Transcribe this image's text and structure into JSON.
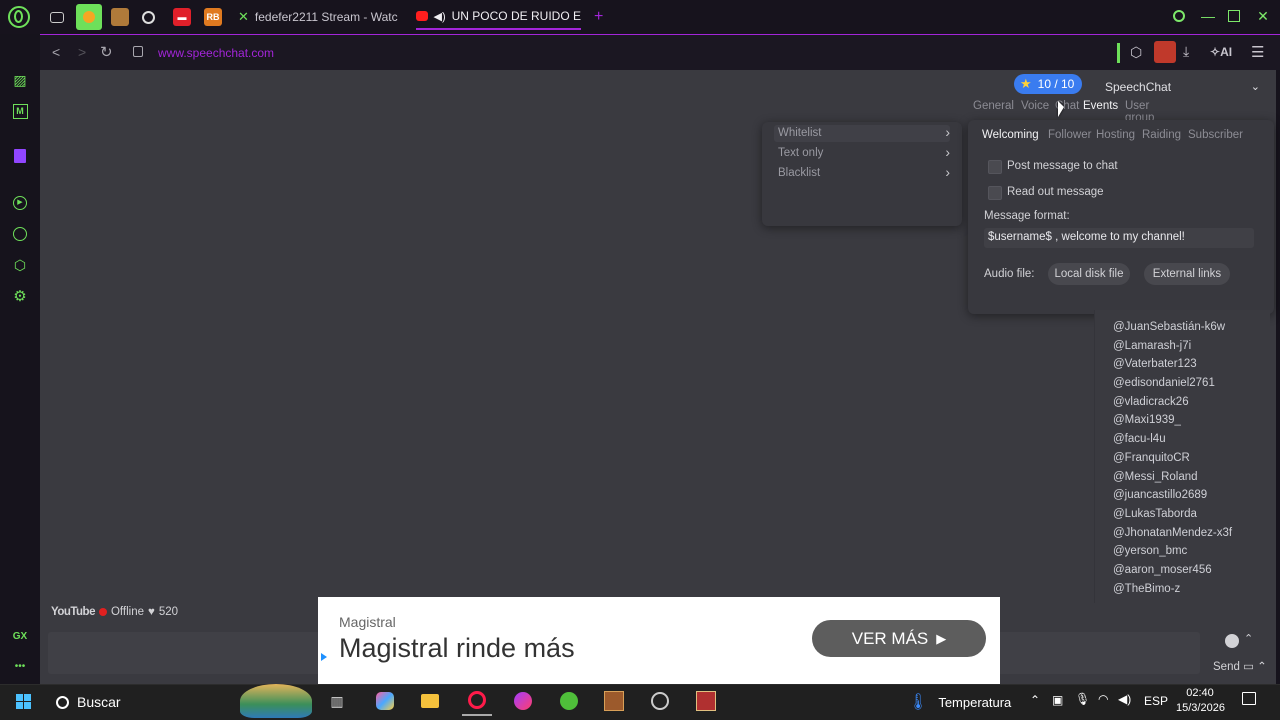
{
  "browser": {
    "tabs": [
      {
        "label": "fedefer2211 Stream - Watc",
        "icon": "twitch-extension-icon"
      },
      {
        "label": "UN POCO DE RUIDO E",
        "icon": "youtube-icon"
      }
    ],
    "new_tab": "+",
    "address": "www.speechchat.com",
    "ai_label": "AI",
    "accent_color": "#a325d9",
    "gx_green": "#6ee05a"
  },
  "sidebar": {
    "gx_label": "GX",
    "more": "•••"
  },
  "speechchat": {
    "rating": "10 / 10",
    "channel_select": "SpeechChat",
    "main_tabs": [
      "General",
      "Voice",
      "Chat",
      "Events",
      "User group"
    ],
    "active_main_tab": "Events",
    "list_menu": [
      "Whitelist",
      "Text only",
      "Blacklist"
    ],
    "event_tabs": [
      "Welcoming",
      "Follower",
      "Hosting",
      "Raiding",
      "Subscriber"
    ],
    "active_event_tab": "Welcoming",
    "post_message": "Post message to chat",
    "read_out": "Read out message",
    "message_format_label": "Message format:",
    "message_format_value": "$username$ , welcome to my channel!",
    "audio_file_label": "Audio file:",
    "local_disk_button": "Local disk file",
    "external_links_button": "External links"
  },
  "users": [
    "@JuanSebastián-k6w",
    "@Lamarash-j7i",
    "@Vaterbater123",
    "@edisondaniel2761",
    "@vladicrack26",
    "@Maxi1939_",
    "@facu-l4u",
    "@FranquitoCR",
    "@Messi_Roland",
    "@juancastillo2689",
    "@LukasTaborda",
    "@JhonatanMendez-x3f",
    "@yerson_bmc",
    "@aaron_moser456",
    "@TheBimo-z"
  ],
  "status": {
    "platform": "YouTube",
    "state": "Offline",
    "likes": "520",
    "send_label": "Send"
  },
  "ad": {
    "brand": "Magistral",
    "headline": "Magistral rinde más",
    "cta": "VER MÁS"
  },
  "taskbar": {
    "search": "Buscar",
    "weather": "Temperatura",
    "lang": "ESP",
    "time": "02:40",
    "date": "15/3/2026"
  }
}
